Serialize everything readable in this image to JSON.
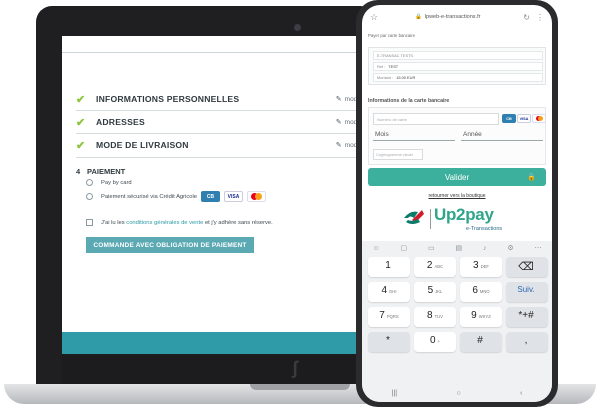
{
  "laptop": {
    "steps": [
      {
        "title": "INFORMATIONS PERSONNELLES",
        "edit": "modifi"
      },
      {
        "title": "ADRESSES",
        "edit": "modifi"
      },
      {
        "title": "MODE DE LIVRAISON",
        "edit": "modifi"
      }
    ],
    "payment": {
      "number": "4",
      "title": "PAIEMENT",
      "option_card": "Pay by card",
      "option_ca": "Paiement sécurisé via Crédit Agricole",
      "terms_prefix": "J'ai lu les",
      "terms_link": "conditions générales de vente",
      "terms_suffix": "et j'y adhère sans réserve.",
      "order_button": "COMMANDE AVEC OBLIGATION DE PAIEMENT"
    }
  },
  "phone": {
    "url": "lpweb-e-transactions.fr",
    "caption": "Payer par carte bancaire",
    "info_rows": [
      {
        "label": "E-TRANSAC TESTS",
        "value": ""
      },
      {
        "label": "Ref :",
        "value": "TEST"
      },
      {
        "label": "Montant :",
        "value": "15.00 EUR"
      }
    ],
    "section_title": "Informations de la carte bancaire",
    "card_number_placeholder": "Numéro de carte",
    "month_label": "Mois",
    "year_label": "Année",
    "cvv_placeholder": "Cryptogramme visuel",
    "validate_label": "Valider",
    "back_link": "retourner vers la boutique",
    "brand_name": "Up2pay",
    "brand_sub": "e-Transactions",
    "card_labels": {
      "cb": "CB",
      "visa": "VISA"
    },
    "keys": [
      {
        "n": "1",
        "l": ""
      },
      {
        "n": "2",
        "l": "ABC"
      },
      {
        "n": "3",
        "l": "DEF"
      },
      {
        "n": "⌫",
        "l": ""
      },
      {
        "n": "4",
        "l": "GHI"
      },
      {
        "n": "5",
        "l": "JKL"
      },
      {
        "n": "6",
        "l": "MNO"
      },
      {
        "n": "Suiv.",
        "l": ""
      },
      {
        "n": "7",
        "l": "PQRS"
      },
      {
        "n": "8",
        "l": "TUV"
      },
      {
        "n": "9",
        "l": "WXYZ"
      },
      {
        "n": "*+#",
        "l": ""
      },
      {
        "n": "*",
        "l": ""
      },
      {
        "n": "0",
        "l": "+"
      },
      {
        "n": "#",
        "l": ""
      },
      {
        "n": ",",
        "l": ""
      }
    ]
  },
  "colors": {
    "teal": "#2f9aa8",
    "button": "#5ba9b3",
    "validate": "#3cb09c",
    "check": "#8cc63f",
    "brand": "#2fa58a"
  }
}
